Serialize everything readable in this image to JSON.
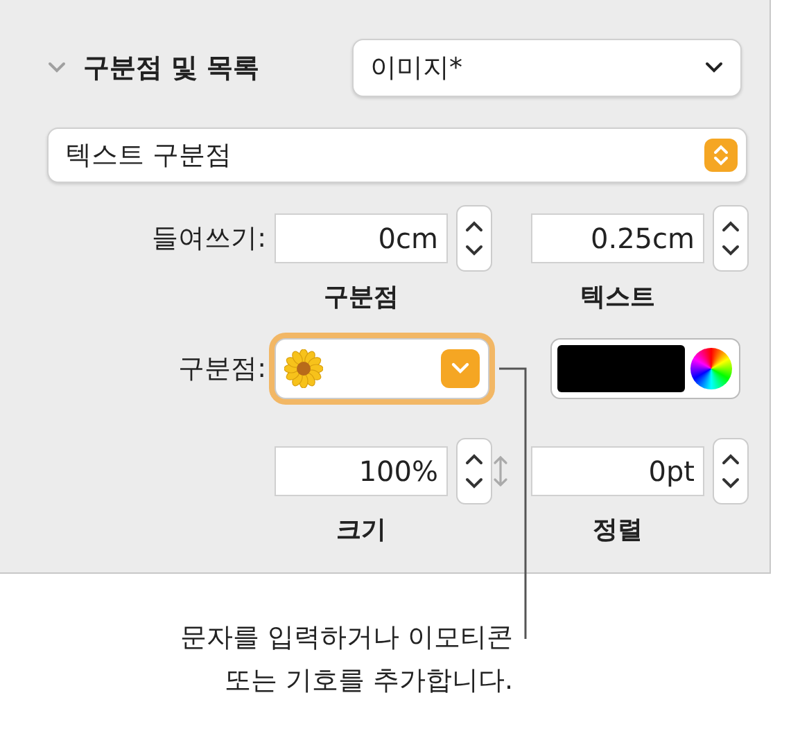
{
  "section": {
    "title": "구분점 및 목록",
    "expanded": true,
    "style_popup": "이미지*"
  },
  "bullet_type_popup": "텍스트 구분점",
  "indent": {
    "label": "들여쓰기:",
    "fields": [
      {
        "value": "0cm",
        "caption": "구분점"
      },
      {
        "value": "0.25cm",
        "caption": "텍스트"
      }
    ]
  },
  "bullet": {
    "label": "구분점:",
    "focused": true
  },
  "size_align": {
    "fields": [
      {
        "value": "100%",
        "caption": "크기"
      },
      {
        "value": "0pt",
        "caption": "정렬"
      }
    ]
  },
  "callout": "문자를 입력하거나 이모티콘\n또는 기호를 추가합니다."
}
